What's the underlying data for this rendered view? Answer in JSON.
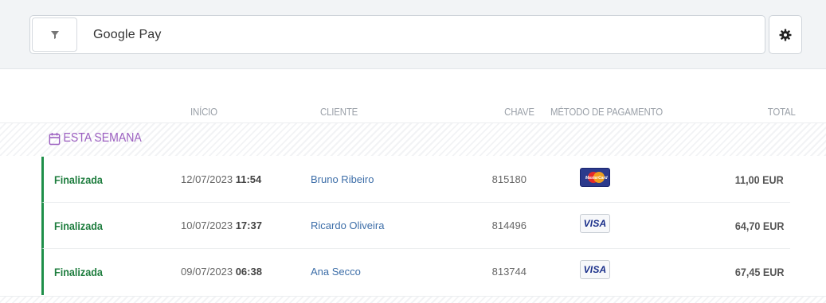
{
  "search": {
    "value": "Google Pay"
  },
  "icons": {
    "filter": "filter-icon",
    "settings": "gear-icon",
    "calendar": "calendar-icon"
  },
  "table": {
    "headers": {
      "start": "INÍCIO",
      "client": "CLIENTE",
      "key": "CHAVE",
      "payment": "MÉTODO DE PAGAMENTO",
      "total": "TOTAL"
    },
    "group_label": "ESTA SEMANA",
    "rows": [
      {
        "status": "Finalizada",
        "date": "12/07/2023",
        "time": "11:54",
        "client": "Bruno Ribeiro",
        "key": "815180",
        "payment": "mastercard",
        "card_text": "MasterCard",
        "total": "11,00 EUR"
      },
      {
        "status": "Finalizada",
        "date": "10/07/2023",
        "time": "17:37",
        "client": "Ricardo Oliveira",
        "key": "814496",
        "payment": "visa",
        "card_text": "VISA",
        "total": "64,70 EUR"
      },
      {
        "status": "Finalizada",
        "date": "09/07/2023",
        "time": "06:38",
        "client": "Ana Secco",
        "key": "813744",
        "payment": "visa",
        "card_text": "VISA",
        "total": "67,45 EUR"
      }
    ]
  },
  "colors": {
    "status_green": "#1e7d3e",
    "group_purple": "#9b5fc0",
    "client_blue": "#3d6ea8"
  }
}
